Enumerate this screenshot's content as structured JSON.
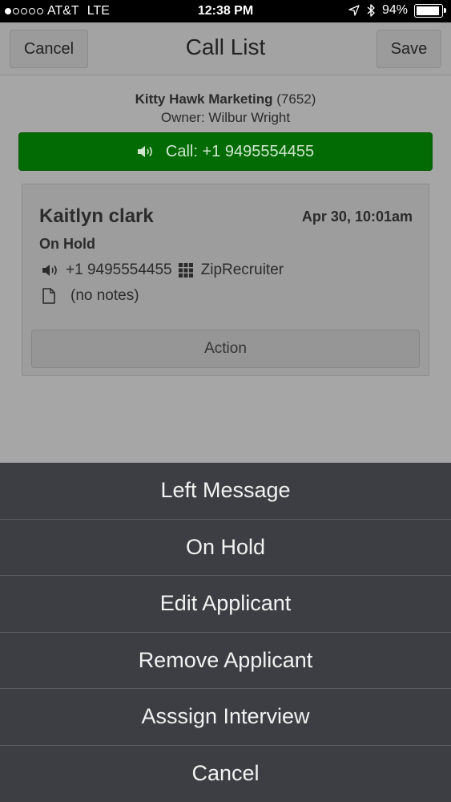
{
  "status_bar": {
    "carrier": "AT&T",
    "network": "LTE",
    "time": "12:38 PM",
    "battery_percent": "94%",
    "battery_level": 0.94,
    "signal_bars_filled": 1,
    "signal_bars_total": 5
  },
  "navbar": {
    "title": "Call List",
    "cancel_label": "Cancel",
    "save_label": "Save"
  },
  "company": {
    "name": "Kitty Hawk Marketing",
    "code": "(7652)",
    "owner": "Owner: Wilbur Wright"
  },
  "call_button": {
    "label": "Call: +1 9495554455",
    "color": "#036b03"
  },
  "applicant": {
    "name": "Kaitlyn clark",
    "date": "Apr 30, 10:01am",
    "status": "On Hold",
    "phone": "+1 9495554455",
    "source": "ZipRecruiter",
    "notes": "(no notes)",
    "action_label": "Action"
  },
  "action_sheet": {
    "items": [
      {
        "label": "Left Message"
      },
      {
        "label": "On Hold"
      },
      {
        "label": "Edit Applicant"
      },
      {
        "label": "Remove Applicant"
      },
      {
        "label": "Asssign Interview"
      },
      {
        "label": "Cancel"
      }
    ]
  },
  "icons": {
    "speaker": "speaker-icon",
    "grid": "grid-icon",
    "document": "document-icon",
    "bluetooth": "bluetooth-icon",
    "location": "location-arrow-icon",
    "battery": "battery-icon"
  }
}
